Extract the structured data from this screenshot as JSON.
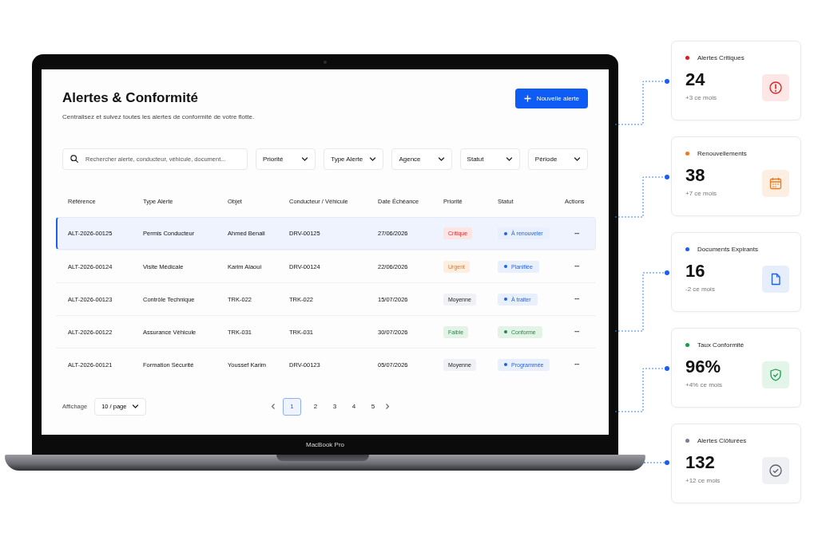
{
  "screen": {
    "title": "Alertes & Conformité",
    "subtitle": "Centralisez et suivez toutes les alertes de conformité de votre flotte.",
    "new_button": "Nouvelle alerte",
    "search": {
      "placeholder": "Rechercher alerte, conducteur, véhicule, document..."
    },
    "filters": [
      "Priorité",
      "Type Alerte",
      "Agence",
      "Statut",
      "Période"
    ],
    "table": {
      "columns": [
        "Référence",
        "Type Alerte",
        "Objet",
        "Conducteur / Véhicule",
        "Date Échéance",
        "Priorité",
        "Statut",
        "Actions"
      ],
      "rows": [
        {
          "selected": true,
          "cells": [
            "ALT-2026-00125",
            "Permis Conducteur",
            "Ahmed Benali",
            "DRV-00125",
            "27/06/2026"
          ],
          "priority": {
            "label": "Critique",
            "kind": "critical"
          },
          "status": {
            "label": "À renouveler",
            "kind": "info"
          },
          "actions": "···"
        },
        {
          "selected": false,
          "cells": [
            "ALT-2026-00124",
            "Visite Médicale",
            "Karim Alaoui",
            "DRV-00124",
            "22/06/2026"
          ],
          "priority": {
            "label": "Urgent",
            "kind": "urgent"
          },
          "status": {
            "label": "Planifiée",
            "kind": "info"
          },
          "actions": "···"
        },
        {
          "selected": false,
          "cells": [
            "ALT-2026-00123",
            "Contrôle Technique",
            "TRK-022",
            "TRK-022",
            "15/07/2026"
          ],
          "priority": {
            "label": "Moyenne",
            "kind": "medium"
          },
          "status": {
            "label": "À traiter",
            "kind": "info"
          },
          "actions": "···"
        },
        {
          "selected": false,
          "cells": [
            "ALT-2026-00122",
            "Assurance Véhicule",
            "TRK-031",
            "TRK-031",
            "30/07/2026"
          ],
          "priority": {
            "label": "Faible",
            "kind": "low"
          },
          "status": {
            "label": "Conforme",
            "kind": "success"
          },
          "actions": "···"
        },
        {
          "selected": false,
          "cells": [
            "ALT-2026-00121",
            "Formation Sécurité",
            "Youssef Karim",
            "DRV-00123",
            "05/07/2026"
          ],
          "priority": {
            "label": "Moyenne",
            "kind": "medium"
          },
          "status": {
            "label": "Programmée",
            "kind": "info"
          },
          "actions": "···"
        }
      ]
    },
    "pagination": {
      "label": "Affichage",
      "page_size": "10 / page",
      "pages": [
        {
          "label": "1",
          "selected": true
        },
        {
          "label": "2",
          "selected": false
        },
        {
          "label": "3",
          "selected": false
        },
        {
          "label": "4",
          "selected": false
        },
        {
          "label": "5",
          "selected": false
        }
      ]
    }
  },
  "laptop_label": "MacBook Pro",
  "stats": [
    {
      "title": "Alertes Critiques",
      "color": "#e01b1b",
      "value": "24",
      "delta": "+3 ce mois",
      "kind": "critical"
    },
    {
      "title": "Renouvellements",
      "color": "#f07a1a",
      "value": "38",
      "delta": "+7 ce mois",
      "kind": "renewal"
    },
    {
      "title": "Documents Expirants",
      "color": "#1a5ff0",
      "value": "16",
      "delta": "-2 ce mois",
      "kind": "document"
    },
    {
      "title": "Taux Conformité",
      "color": "#1a9a4a",
      "value": "96%",
      "delta": "+4% ce mois",
      "kind": "compliance"
    },
    {
      "title": "Alertes Clôturées",
      "color": "#7a7f8c",
      "value": "132",
      "delta": "+12 ce mois",
      "kind": "closed"
    }
  ]
}
